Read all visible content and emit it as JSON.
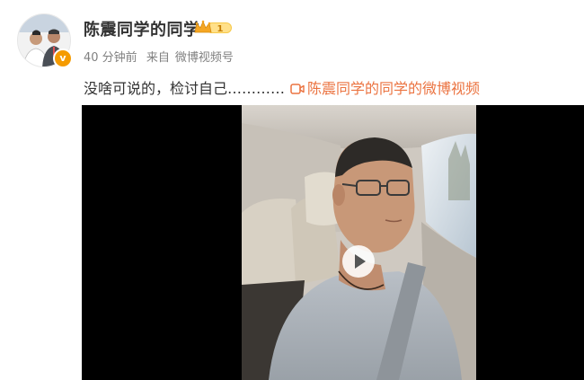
{
  "post": {
    "username": "陈震同学的同学",
    "vip_level": "1",
    "time": "40 分钟前",
    "source_prefix": "来自",
    "source": "微博视频号",
    "text": "没啥可说的，检讨自己…………",
    "video_link_label": "陈震同学的同学的微博视频"
  },
  "badges": {
    "verified_symbol": "v"
  },
  "colors": {
    "link": "#eb7340",
    "badge_gold": "#f5b400",
    "verified": "#f59b00"
  }
}
